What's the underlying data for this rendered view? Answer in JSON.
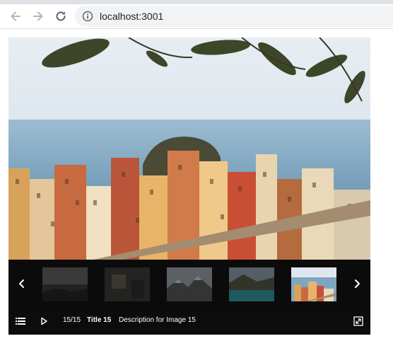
{
  "browser": {
    "url": "localhost:3001",
    "icons": [
      "back-arrow-icon",
      "forward-arrow-icon",
      "reload-icon",
      "info-icon"
    ]
  },
  "gallery": {
    "counter": "15/15",
    "title": "Title 15",
    "description": "Description for Image 15",
    "main_image": "cinque-terre-coastal-village",
    "thumbnails": [
      {
        "subject": "coastal-rocks-sunset",
        "active": false
      },
      {
        "subject": "dark-room-interior",
        "active": false
      },
      {
        "subject": "mountain-landscape",
        "active": false
      },
      {
        "subject": "turquoise-lake-valley",
        "active": false
      },
      {
        "subject": "cinque-terre-village",
        "active": true
      }
    ],
    "icons": [
      "prev-arrow-icon",
      "next-arrow-icon",
      "list-icon",
      "play-icon",
      "fullscreen-icon"
    ]
  }
}
